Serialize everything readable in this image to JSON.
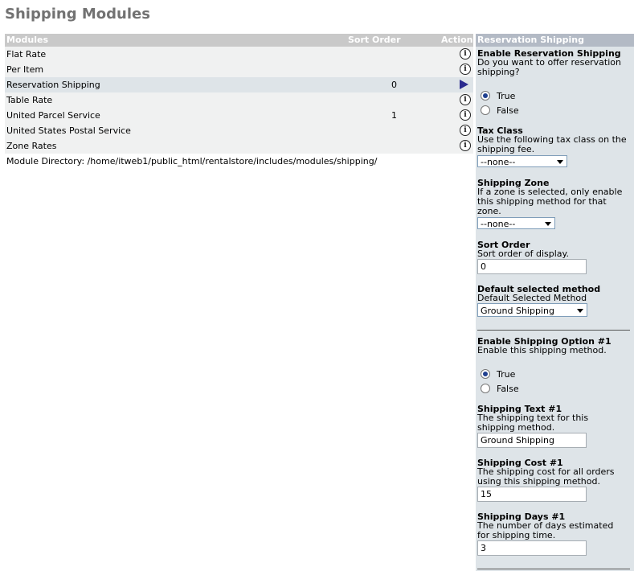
{
  "page": {
    "title": "Shipping Modules"
  },
  "table": {
    "headers": {
      "modules": "Modules",
      "sort_order": "Sort Order",
      "action": "Action"
    },
    "rows": [
      {
        "name": "Flat Rate",
        "sort": "",
        "action_icon": "info-icon"
      },
      {
        "name": "Per Item",
        "sort": "",
        "action_icon": "info-icon"
      },
      {
        "name": "Reservation Shipping",
        "sort": "0",
        "action_icon": "arrow-right-icon"
      },
      {
        "name": "Table Rate",
        "sort": "",
        "action_icon": "info-icon"
      },
      {
        "name": "United Parcel Service",
        "sort": "1",
        "action_icon": "info-icon"
      },
      {
        "name": "United States Postal Service",
        "sort": "",
        "action_icon": "info-icon"
      },
      {
        "name": "Zone Rates",
        "sort": "",
        "action_icon": "info-icon"
      }
    ],
    "info_glyph": "i",
    "module_directory": "Module Directory: /home/itweb1/public_html/rentalstore/includes/modules/shipping/"
  },
  "panel": {
    "title": "Reservation Shipping",
    "enable": {
      "label": "Enable Reservation Shipping",
      "desc": "Do you want to offer reservation shipping?",
      "options": [
        "True",
        "False"
      ],
      "selected": "True"
    },
    "tax_class": {
      "label": "Tax Class",
      "desc": "Use the following tax class on the shipping fee.",
      "value": "--none--"
    },
    "shipping_zone": {
      "label": "Shipping Zone",
      "desc": "If a zone is selected, only enable this shipping method for that zone.",
      "value": "--none--"
    },
    "sort_order": {
      "label": "Sort Order",
      "desc": "Sort order of display.",
      "value": "0"
    },
    "default_method": {
      "label": "Default selected method",
      "desc": "Default Selected Method",
      "value": "Ground Shipping"
    },
    "option1": {
      "label": "Enable Shipping Option #1",
      "desc": "Enable this shipping method.",
      "options": [
        "True",
        "False"
      ],
      "selected": "True"
    },
    "text1": {
      "label": "Shipping Text #1",
      "desc": "The shipping text for this shipping method.",
      "value": "Ground Shipping"
    },
    "cost1": {
      "label": "Shipping Cost #1",
      "desc": "The shipping cost for all orders using this shipping method.",
      "value": "15"
    },
    "days1": {
      "label": "Shipping Days #1",
      "desc": "The number of days estimated for shipping time.",
      "value": "3"
    }
  },
  "colors": {
    "table_header": "#c9c9c9",
    "panel_header": "#b3bac5",
    "panel_bg": "#dee4e8",
    "row_bg": "#f0f1f1",
    "selected_row": "#dee4e8",
    "title": "#727272"
  }
}
